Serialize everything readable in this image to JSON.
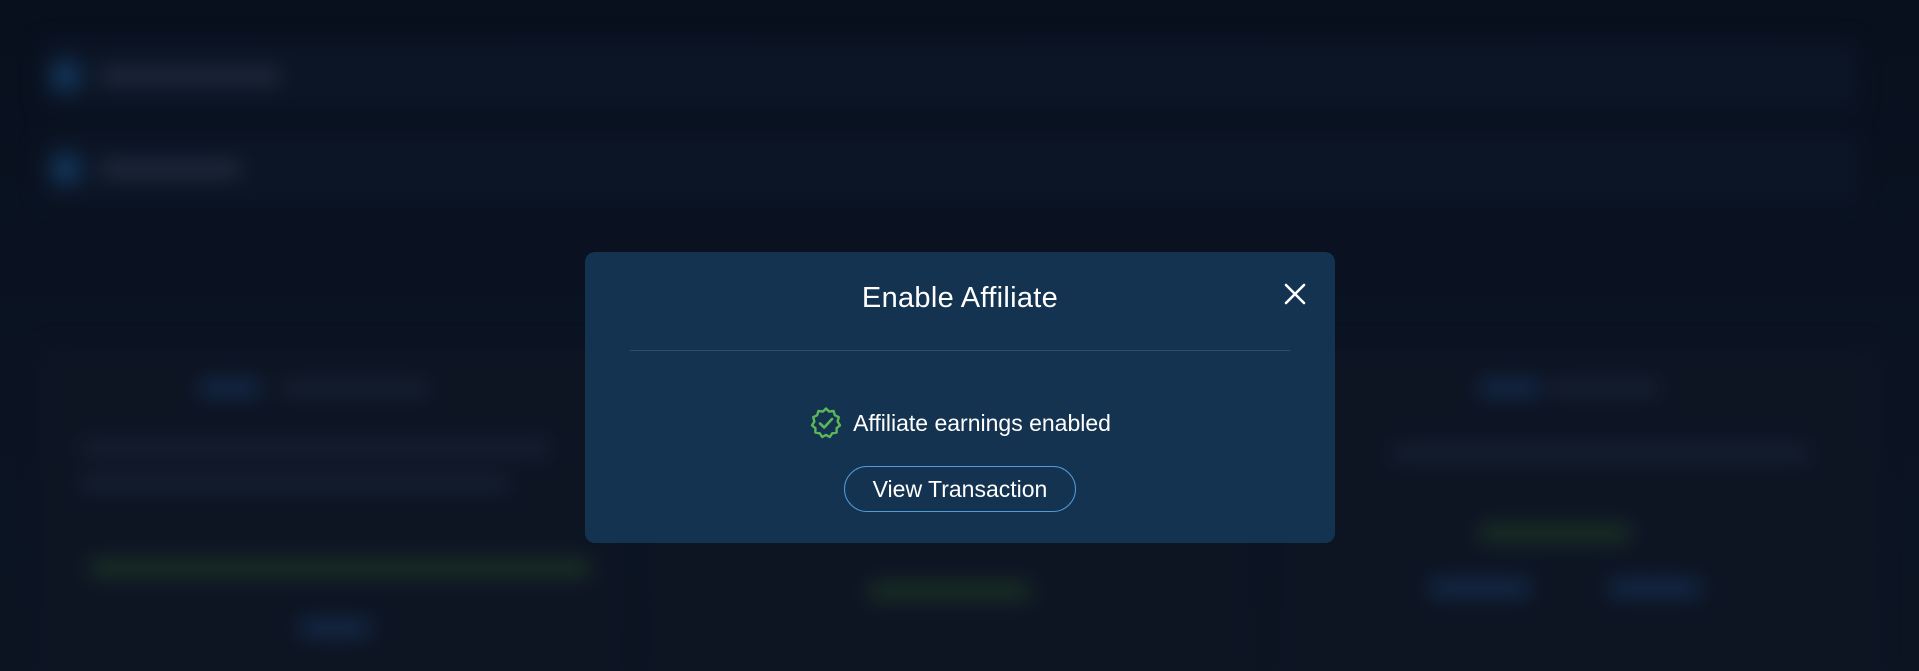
{
  "modal": {
    "title": "Enable Affiliate",
    "close_icon": "close-icon",
    "status_icon": "verified-badge-icon",
    "status_text": "Affiliate earnings enabled",
    "view_transaction_label": "View Transaction"
  },
  "colors": {
    "modal_background": "#143350",
    "success_green": "#5bb85a",
    "button_border": "#4f9cdb",
    "page_background": "#0c1524"
  }
}
